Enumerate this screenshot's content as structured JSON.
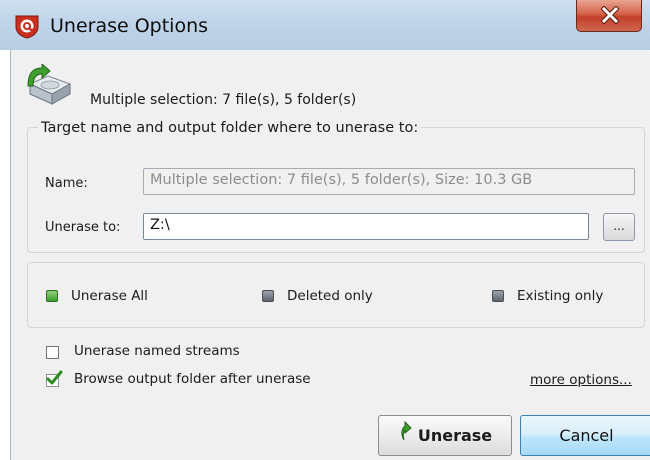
{
  "window": {
    "title": "Unerase Options",
    "close_icon": "close-x-icon",
    "app_icon": "unerase-app-icon"
  },
  "header": {
    "summary": "Multiple selection: 7 file(s), 5 folder(s)",
    "icon": "drive-restore-icon"
  },
  "target_group": {
    "legend": "Target name and output folder where to unerase to:",
    "name_label": "Name:",
    "name_value": "Multiple selection: 7 file(s), 5 folder(s), Size: 10.3 GB",
    "unerase_to_label": "Unerase to:",
    "unerase_to_value": "Z:\\",
    "browse_label": "..."
  },
  "mode_group": {
    "options": [
      {
        "label": "Unerase All",
        "selected": true
      },
      {
        "label": "Deleted only",
        "selected": false
      },
      {
        "label": "Existing only",
        "selected": false
      }
    ]
  },
  "options": {
    "named_streams_label": "Unerase named streams",
    "named_streams_checked": false,
    "browse_after_label": "Browse output folder after unerase",
    "browse_after_checked": true,
    "more_options_label": "more options..."
  },
  "buttons": {
    "unerase_label": "Unerase",
    "cancel_label": "Cancel"
  },
  "colors": {
    "title_bar": "#c0d5ea",
    "dialog_bg": "#f0f0f0",
    "close_red": "#c1402a",
    "selected_green": "#3e9f2e",
    "cancel_blue": "#bee6fd"
  }
}
